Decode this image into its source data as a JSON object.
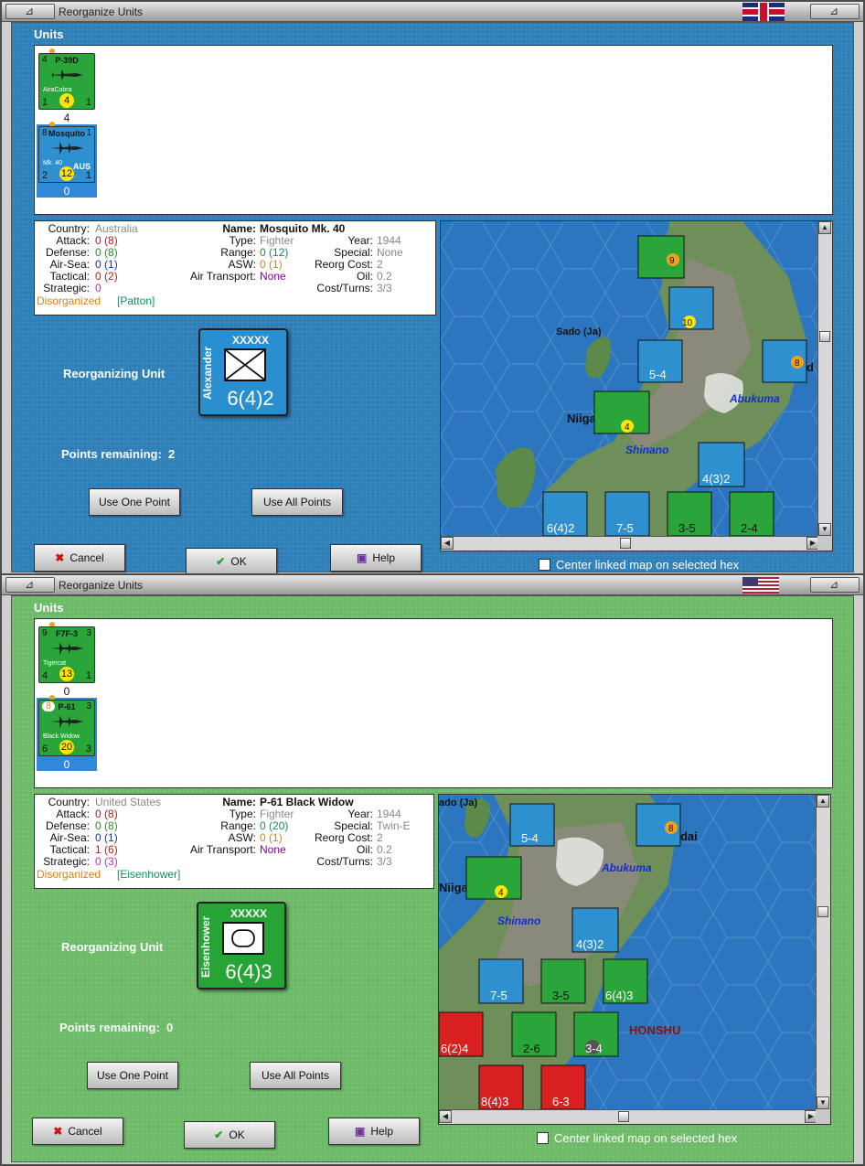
{
  "windows": [
    {
      "title": "Reorganize Units",
      "units_label": "Units",
      "units": [
        {
          "name": "P-39D",
          "subname": "AiraCobra",
          "top_left": "4",
          "top_right": "",
          "attack": "1",
          "defense": "1",
          "range": "4",
          "count": "4",
          "selected": false
        },
        {
          "name": "Mosquito",
          "subname": "Mk. 40",
          "nation": "AUS",
          "top_left": "8",
          "top_right": "1",
          "attack": "2",
          "defense": "1",
          "range": "12",
          "count": "0",
          "selected": true
        }
      ],
      "info": {
        "country_label": "Country:",
        "country": "Australia",
        "attack_label": "Attack:",
        "attack": "0",
        "attack_max": "(8)",
        "defense_label": "Defense:",
        "defense": "0",
        "defense_max": "(8)",
        "airsea_label": "Air-Sea:",
        "airsea": "0",
        "airsea_max": "(1)",
        "tactical_label": "Tactical:",
        "tactical": "0",
        "tactical_max": "(2)",
        "strategic_label": "Strategic:",
        "strategic": "0",
        "strategic_max": "",
        "disorganized": "Disorganized",
        "commander": "[Patton]",
        "name_label": "Name:",
        "name": "Mosquito Mk. 40",
        "type_label": "Type:",
        "type": "Fighter",
        "range_label": "Range:",
        "range": "0",
        "range_max": "(12)",
        "asw_label": "ASW:",
        "asw": "0",
        "asw_max": "(1)",
        "airtransport_label": "Air Transport:",
        "airtransport": "None",
        "year_label": "Year:",
        "year": "1944",
        "special_label": "Special:",
        "special": "None",
        "reorgcost_label": "Reorg Cost:",
        "reorgcost": "2",
        "oil_label": "Oil:",
        "oil": "0.2",
        "costturns_label": "Cost/Turns:",
        "costturns": "3/3"
      },
      "reorganizing_label": "Reorganizing Unit",
      "reorg_unit": {
        "leader": "Alexander",
        "size": "XXXXX",
        "strength": "6(4)2"
      },
      "points_label": "Points remaining:",
      "points": "2",
      "use_one": "Use One Point",
      "use_all": "Use All Points",
      "cancel": "Cancel",
      "ok": "OK",
      "help": "Help",
      "center_linked": "Center linked map on selected hex",
      "map_labels": {
        "sado": "Sado (Ja)",
        "niigata": "Niigat",
        "shinano": "Shinano",
        "abukuma": "Abukuma",
        "ndai": "nd"
      },
      "map_counters": [
        "9",
        "10",
        "5-4",
        "4",
        "8",
        "4(3)2",
        "6(4)2",
        "7-5",
        "3-5",
        "2-4"
      ],
      "flag": "uk"
    },
    {
      "title": "Reorganize Units",
      "units_label": "Units",
      "units": [
        {
          "name": "F7F-3",
          "subname": "Tigercat",
          "top_left": "9",
          "top_right": "3",
          "attack": "4",
          "defense": "1",
          "range": "13",
          "count": "0",
          "selected": false
        },
        {
          "name": "P-61",
          "subname": "Black Widow",
          "top_left": "8",
          "top_right": "3",
          "attack": "6",
          "defense": "3",
          "range": "20",
          "count": "0",
          "selected": true
        }
      ],
      "info": {
        "country_label": "Country:",
        "country": "United States",
        "attack_label": "Attack:",
        "attack": "0",
        "attack_max": "(8)",
        "defense_label": "Defense:",
        "defense": "0",
        "defense_max": "(8)",
        "airsea_label": "Air-Sea:",
        "airsea": "0",
        "airsea_max": "(1)",
        "tactical_label": "Tactical:",
        "tactical": "1",
        "tactical_max": "(6)",
        "strategic_label": "Strategic:",
        "strategic": "0",
        "strategic_max": "(3)",
        "disorganized": "Disorganized",
        "commander": "[Eisenhower]",
        "name_label": "Name:",
        "name": "P-61 Black Widow",
        "type_label": "Type:",
        "type": "Fighter",
        "range_label": "Range:",
        "range": "0",
        "range_max": "(20)",
        "asw_label": "ASW:",
        "asw": "0",
        "asw_max": "(1)",
        "airtransport_label": "Air Transport:",
        "airtransport": "None",
        "year_label": "Year:",
        "year": "1944",
        "special_label": "Special:",
        "special": "Twin-E",
        "reorgcost_label": "Reorg Cost:",
        "reorgcost": "2",
        "oil_label": "Oil:",
        "oil": "0.2",
        "costturns_label": "Cost/Turns:",
        "costturns": "3/3"
      },
      "reorganizing_label": "Reorganizing Unit",
      "reorg_unit": {
        "leader": "Eisenhower",
        "size": "XXXXX",
        "strength": "6(4)3"
      },
      "points_label": "Points remaining:",
      "points": "0",
      "use_one": "Use One Point",
      "use_all": "Use All Points",
      "cancel": "Cancel",
      "ok": "OK",
      "help": "Help",
      "center_linked": "Center linked map on selected hex",
      "map_labels": {
        "sado": "ado (Ja)",
        "niigata": "Niigat",
        "shinano": "Shinano",
        "abukuma": "Abukuma",
        "honshu": "HONSHU",
        "ndai": "ndai"
      },
      "map_counters": [
        "5-4",
        "8",
        "4",
        "4(3)2",
        "7-5",
        "3-5",
        "6(4)3",
        "6(2)4",
        "2-6",
        "3-4",
        "8(4)3",
        "6-3"
      ],
      "flag": "us"
    }
  ],
  "colors": {
    "uk_bg": "#2f7fb8",
    "us_bg": "#6dbb69",
    "counter_green": "#2aa53a",
    "counter_blue": "#2f90cf",
    "counter_red": "#d82020"
  }
}
